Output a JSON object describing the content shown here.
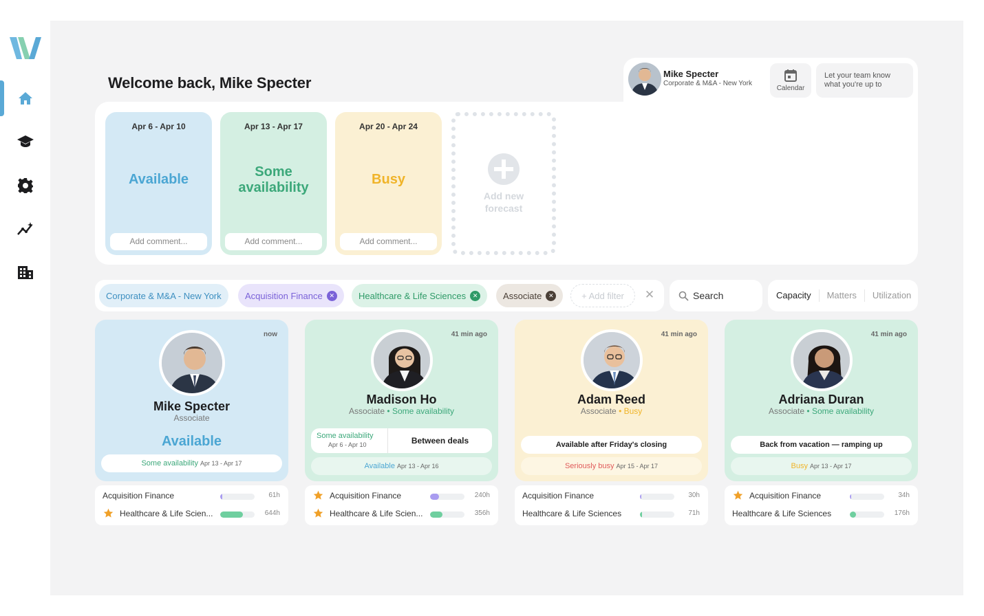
{
  "sidebar": {
    "logo": "W",
    "items": [
      {
        "icon": "home-icon",
        "active": true
      },
      {
        "icon": "graduation-cap-icon",
        "active": false
      },
      {
        "icon": "gear-icon",
        "active": false
      },
      {
        "icon": "analytics-icon",
        "active": false
      },
      {
        "icon": "building-icon",
        "active": false
      }
    ]
  },
  "header": {
    "welcome": "Welcome back, Mike Specter",
    "user": {
      "name": "Mike Specter",
      "group": "Corporate & M&A - New York"
    },
    "calendar_label": "Calendar",
    "status_placeholder": "Let your team know what you're up to"
  },
  "forecast": {
    "cards": [
      {
        "range": "Apr 6 - Apr 10",
        "status": "Available",
        "comment_placeholder": "Add comment..."
      },
      {
        "range": "Apr 13 - Apr 17",
        "status": "Some availability",
        "comment_placeholder": "Add comment..."
      },
      {
        "range": "Apr 20 - Apr 24",
        "status": "Busy",
        "comment_placeholder": "Add comment..."
      }
    ],
    "add_label": "Add new forecast"
  },
  "filters": {
    "chips": [
      {
        "label": "Corporate & M&A - New York",
        "removable": false
      },
      {
        "label": "Acquisition Finance",
        "removable": true
      },
      {
        "label": "Healthcare & Life Sciences",
        "removable": true
      },
      {
        "label": "Associate",
        "removable": true
      }
    ],
    "add_label": "+ Add filter",
    "search_placeholder": "Search",
    "views": [
      "Capacity",
      "Matters",
      "Utilization"
    ],
    "active_view": "Capacity"
  },
  "people": [
    {
      "name": "Mike Specter",
      "role": "Associate",
      "updated": "now",
      "status": "Available",
      "next": {
        "status": "Some availability",
        "range": "Apr 13 - Apr 17"
      },
      "stats": [
        {
          "matter": "Acquisition Finance",
          "starred": false,
          "hours": "61h",
          "fill": 0.06,
          "color": "#a99cf0"
        },
        {
          "matter": "Healthcare & Life Scien...",
          "starred": true,
          "hours": "644h",
          "fill": 0.65,
          "color": "#6fcf9f"
        }
      ]
    },
    {
      "name": "Madison Ho",
      "role": "Associate",
      "updated": "41 min ago",
      "status": "Some availability",
      "current": {
        "status": "Some availability",
        "range": "Apr 6 - Apr 10"
      },
      "comment": "Between deals",
      "next": {
        "status": "Available",
        "range": "Apr 13 - Apr 16"
      },
      "stats": [
        {
          "matter": "Acquisition Finance",
          "starred": true,
          "hours": "240h",
          "fill": 0.25,
          "color": "#a99cf0"
        },
        {
          "matter": "Healthcare & Life Scien...",
          "starred": true,
          "hours": "356h",
          "fill": 0.36,
          "color": "#6fcf9f"
        }
      ]
    },
    {
      "name": "Adam Reed",
      "role": "Associate",
      "updated": "41 min ago",
      "status": "Busy",
      "comment": "Available after Friday's closing",
      "next": {
        "status": "Seriously busy",
        "range": "Apr 15 - Apr 17"
      },
      "stats": [
        {
          "matter": "Acquisition Finance",
          "starred": false,
          "hours": "30h",
          "fill": 0.03,
          "color": "#a99cf0"
        },
        {
          "matter": "Healthcare & Life Sciences",
          "starred": false,
          "hours": "71h",
          "fill": 0.06,
          "color": "#6fcf9f"
        }
      ]
    },
    {
      "name": "Adriana Duran",
      "role": "Associate",
      "updated": "41 min ago",
      "status": "Some availability",
      "comment": "Back from vacation — ramping up",
      "next": {
        "status": "Busy",
        "range": "Apr 13 - Apr 17"
      },
      "stats": [
        {
          "matter": "Acquisition Finance",
          "starred": true,
          "hours": "34h",
          "fill": 0.04,
          "color": "#a99cf0"
        },
        {
          "matter": "Healthcare & Life Sciences",
          "starred": false,
          "hours": "176h",
          "fill": 0.18,
          "color": "#6fcf9f"
        }
      ]
    }
  ],
  "colors": {
    "available": "#4ba6d3",
    "some": "#3ca87a",
    "busy": "#f0b429",
    "seriously_busy": "#e05a5a",
    "card_blue": "#d4e9f5",
    "card_green": "#d4efe2",
    "card_yellow": "#fbf0d3",
    "chip_blue": "#e1eff8",
    "chip_purple": "#e9e4fb",
    "chip_green": "#dcf2e7",
    "chip_tan": "#ece7e1"
  }
}
